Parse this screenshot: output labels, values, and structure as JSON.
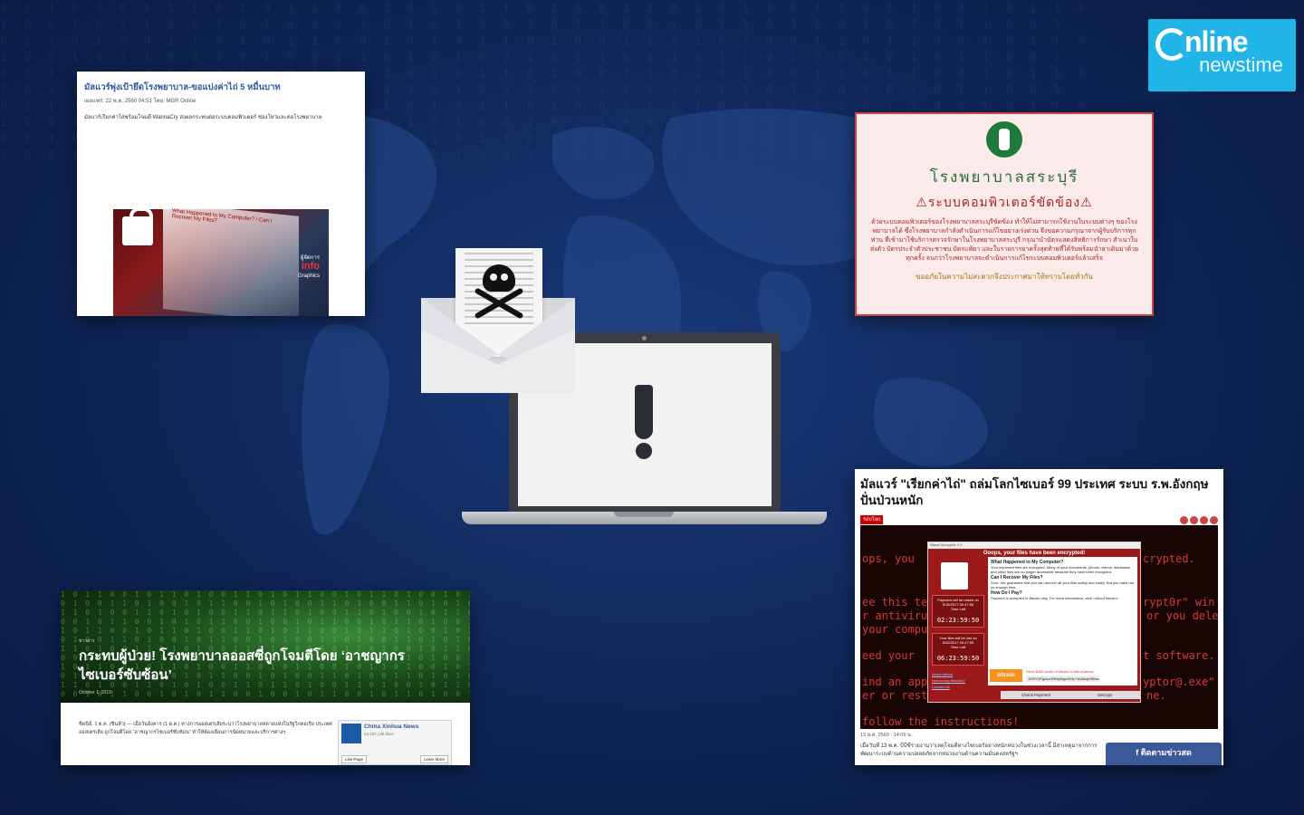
{
  "logo": {
    "line1": "nline",
    "line2": "newstime"
  },
  "card1": {
    "title": "มัลแวร์พุ่งเป้ายึดโรงพยาบาล-ขอแบ่งค่าไถ่ 5 หมื่นบาท",
    "meta": "เผยแพร่: 22 พ.ค. 2560 04:51   โดย: MGR Online",
    "body": "มัลแวร์เรียกค่าไถ่พร้อมโจมตี WannaCry ส่งผลกระทบต่อระบบคอมพิวเตอร์ ช่องโหว่และต่อโรงพยาบาล",
    "img_text": "What Happened to My Computer? / Can I Recover My Files?",
    "brand_small": "ผู้จัดการ",
    "brand_big": "info",
    "brand_sub": "Graphics"
  },
  "card2": {
    "h1": "โรงพยาบาลสระบุรี",
    "h2": "⚠ระบบคอมพิวเตอร์ขัดข้อง⚠",
    "p": "ด้วยระบบคอมพิวเตอร์ของโรงพยาบาลสระบุรีขัดข้อง ทำให้ไม่สามารถใช้งานในระบบต่างๆ ของโรงพยาบาลได้ ซึ่งโรงพยาบาลกำลังดำเนินการแก้ไขอย่างเร่งด่วน จึงขอความกรุณาจากผู้รับบริการทุกท่าน ที่เข้ามาใช้บริการตรวจรักษาในโรงพยาบาลสระบุรี กรุณานำบัตรแสดงสิทธิการรักษา สำเนาใบส่งตัว บัตรประจำตัวประชาชน บัตรแพ้ยา และใบรายการยาครั้งสุดท้ายที่ได้รับพร้อมนำยาเดิมมาด้วยทุกครั้ง จนกว่าโรงพยาบาลจะดำเนินการแก้ไขระบบคอมพิวเตอร์แล้วเสร็จ",
    "foot": "ขออภัยในความไม่สะดวกจึงประกาศมาให้ทราบโดยทั่วกัน"
  },
  "card3": {
    "category": "ข่าวสาร",
    "headline": "กระทบผู้ป่วย! โรงพยาบาลออสซี่ถูกโจมตีโดย ‘อาชญากรไซเบอร์ซับซ้อน’",
    "date": "October 1, 2019",
    "text": "ซิดนีย์, 1 ต.ค. (ซินหัว) — เมื่อวันอังคาร (1 ต.ค.) ทางการออสเตรเลียระบุว่าโรงพยาบาลหลายแห่งในรัฐวิกตอเรีย ประเทศออสเตรเลีย ถูกโจมตีโดย “อาชญากรไซเบอร์ซับซ้อน” ทำให้ต้องเลื่อนการนัดหมายและบริการต่างๆ",
    "fb_name": "China Xinhua News",
    "fb_likes": "84,297,136 likes",
    "fb_like_btn": "Like Page",
    "fb_learn_btn": "Learn More"
  },
  "card4": {
    "headline": "มัลแวร์ \"เรียกค่าไถ่\" ถล่มโลกไซเบอร์ 99 ประเทศ ระบบ ร.พ.อังกฤษปั่นป่วนหนัก",
    "tag": "รอบโลก",
    "bg_lines": [
      "ops, you",
      "crypted.",
      "ee this te",
      "rypt0r\" win",
      "r antiviru",
      "or you dele",
      "your compu",
      "eed your",
      "t software.",
      "ind an app",
      "yptor@.exe\"",
      "er or rest",
      "ne.",
      "follow the instructions!"
    ],
    "win_title": "Wana Decrypt0r 2.0",
    "win_header": "Ooops, your files have been encrypted!",
    "win_lang": "English",
    "q1": "What Happened to My Computer?",
    "a1": "Your important files are encrypted. Many of your documents, photos, videos, databases and other files are no longer accessible because they have been encrypted.",
    "q2": "Can I Recover My Files?",
    "a2": "Sure. We guarantee that you can recover all your files safely and easily. But you have not so enough time.",
    "q3": "How Do I Pay?",
    "a3": "Payment is accepted in Bitcoin only. For more information, click <About bitcoin>.",
    "timer1_label": "Payment will be raised on",
    "timer1_date": "5/16/2017 00:47:55",
    "timer1_left": "Time Left",
    "timer1_val": "02:23:59:50",
    "timer2_label": "Your files will be lost on",
    "timer2_date": "5/20/2017 00:47:55",
    "timer2_left": "Time Left",
    "timer2_val": "06:23:59:50",
    "link1": "About bitcoin",
    "link2": "How to buy bitcoins?",
    "link3": "Contact Us",
    "btc_logo": "bitcoin",
    "btc_send": "Send $300 worth of bitcoin to this address:",
    "btc_addr": "12t9YDPgwueZ9NyMgw519p7AA8isjr6SMw",
    "btn_check": "Check Payment",
    "btn_decrypt": "Decrypt",
    "date": "13 พ.ค. 2560 - 14:09 น.",
    "para": "เมื่อวันที่ 13 พ.ค. บีบีซีรายงานว่าเหตุโจมตีทางไซเบอร์อย่างหนักหน่วงในช่วงเวลานี้ มีสาเหตุมาจากการพัฒนาระบบด้านความปลอดภัยจากหน่วยงานด้านความมั่นคงสหรัฐฯ",
    "follow": "ติดตามข่าวสด"
  }
}
